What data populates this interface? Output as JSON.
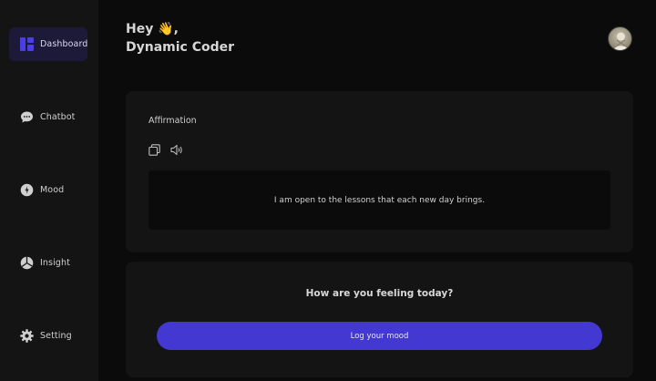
{
  "sidebar": {
    "items": [
      {
        "label": "Dashboard",
        "icon": "dashboard-icon",
        "active": true
      },
      {
        "label": "Chatbot",
        "icon": "chat-bubble-icon"
      },
      {
        "label": "Mood",
        "icon": "mood-icon"
      },
      {
        "label": "Insight",
        "icon": "pie-chart-icon"
      },
      {
        "label": "Setting",
        "icon": "gear-icon"
      }
    ]
  },
  "header": {
    "greeting": "Hey 👋,",
    "name": "Dynamic Coder"
  },
  "affirmation": {
    "title": "Affirmation",
    "text": "I am open to the lessons that each new day brings.",
    "copy_icon": "copy-icon",
    "speaker_icon": "speaker-icon"
  },
  "mood": {
    "question": "How are you feeling today?",
    "button_label": "Log your mood"
  },
  "colors": {
    "accent": "#4338d1",
    "active_nav": "#1c1a38",
    "background": "#0b0b0c",
    "panel": "#141415"
  }
}
